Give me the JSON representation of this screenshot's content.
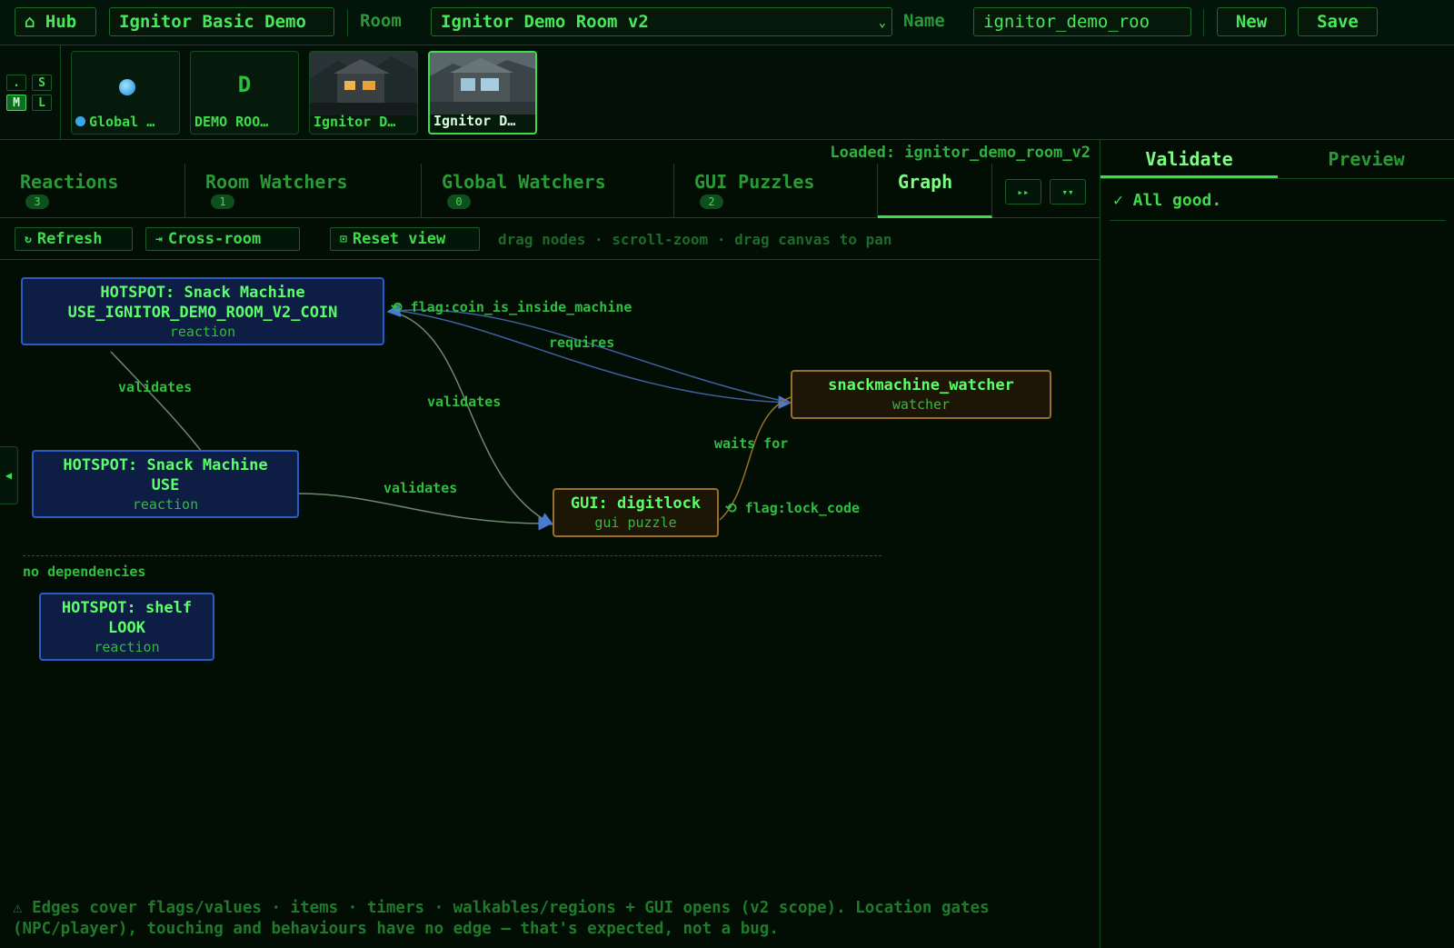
{
  "topbar": {
    "hub_label": "⌂ Hub",
    "project_label": "Ignitor Basic Demo",
    "room_label": "Room",
    "room_select_value": "Ignitor Demo Room v2",
    "name_label": "Name",
    "name_value": "ignitor_demo_roo",
    "new_label": "New",
    "save_label": "Save"
  },
  "size_buttons": [
    ".",
    "S",
    "M",
    "L"
  ],
  "thumbnails": [
    {
      "label": "Global …",
      "kind": "globe-icon"
    },
    {
      "label": "DEMO ROO…",
      "letter": "D"
    },
    {
      "label": "Ignitor D…",
      "kind": "image"
    },
    {
      "label": "Ignitor D…",
      "kind": "image",
      "active": true
    }
  ],
  "status": {
    "loaded": "Loaded: ignitor_demo_room_v2"
  },
  "tabs": [
    {
      "label": "Reactions",
      "badge": "3"
    },
    {
      "label": "Room Watchers",
      "badge": "1"
    },
    {
      "label": "Global Watchers",
      "badge": "0"
    },
    {
      "label": "GUI Puzzles",
      "badge": "2"
    },
    {
      "label": "Graph",
      "badge": "",
      "active": true
    }
  ],
  "tab_controls": [
    "▸▸",
    "▾▾"
  ],
  "toolbar": {
    "refresh": "Refresh",
    "cross_room": "Cross-room",
    "reset_view": "Reset view",
    "hint": "drag nodes · scroll-zoom · drag canvas to pan"
  },
  "graph": {
    "nodes": {
      "coin": {
        "title": "HOTSPOT: Snack Machine",
        "subtitle": "USE_IGNITOR_DEMO_ROOM_V2_COIN",
        "kind": "reaction"
      },
      "use": {
        "title": "HOTSPOT: Snack Machine",
        "subtitle": "USE",
        "kind": "reaction"
      },
      "watcher": {
        "title": "snackmachine_watcher",
        "kind": "watcher"
      },
      "gui": {
        "title": "GUI: digitlock",
        "kind": "gui puzzle"
      },
      "shelf": {
        "title": "HOTSPOT: shelf",
        "subtitle": "LOOK",
        "kind": "reaction"
      }
    },
    "edges": {
      "flag_coin": "⟲ flag:coin_is_inside_machine",
      "requires": "requires",
      "validates_1": "validates",
      "validates_2": "validates",
      "validates_3": "validates",
      "waits_for": "waits for",
      "flag_lock": "⟲ flag:lock_code"
    },
    "no_deps": "no dependencies"
  },
  "footer_note": "⚠ Edges cover flags/values · items · timers · walkables/regions + GUI opens (v2 scope). Location gates (NPC/player), touching and behaviours have no edge — that's expected, not a bug.",
  "right_panel": {
    "tabs": [
      "Validate",
      "Preview"
    ],
    "result": "✓ All good."
  },
  "colors": {
    "accent": "#3ddc4a",
    "background": "#020d04",
    "reaction_fill": "#0d1d43",
    "reaction_border": "#2b5bc7",
    "watcher_border": "#9a6f2a"
  }
}
